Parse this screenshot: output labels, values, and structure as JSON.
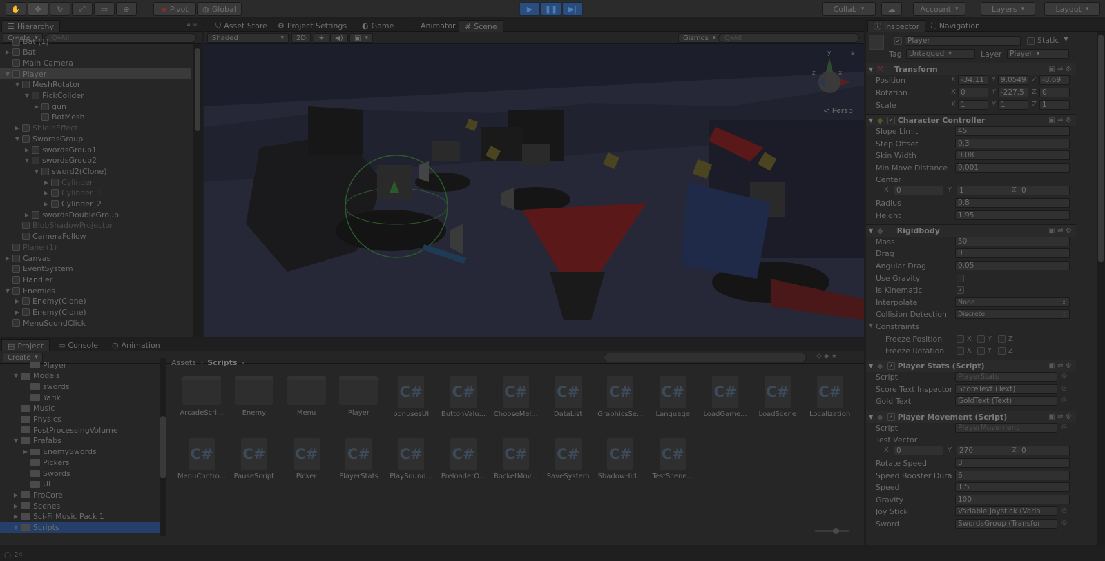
{
  "toolbar": {
    "pivot": "Pivot",
    "global": "Global",
    "collab": "Collab",
    "account": "Account",
    "layers": "Layers",
    "layout": "Layout"
  },
  "hierarchy": {
    "tab": "Hierarchy",
    "create": "Create",
    "search_placeholder": "Q▾All",
    "rows": [
      {
        "label": "Bat (1)",
        "indent": 1,
        "arrow": "",
        "dim": false
      },
      {
        "label": "Bat",
        "indent": 1,
        "arrow": "▶",
        "dim": false
      },
      {
        "label": "Main Camera",
        "indent": 1,
        "arrow": "",
        "dim": false
      },
      {
        "label": "Player",
        "indent": 1,
        "arrow": "▼",
        "dim": false,
        "sel": true
      },
      {
        "label": "MeshRotator",
        "indent": 2,
        "arrow": "▼",
        "dim": false
      },
      {
        "label": "PickColider",
        "indent": 3,
        "arrow": "▼",
        "dim": false
      },
      {
        "label": "gun",
        "indent": 4,
        "arrow": "▶",
        "dim": false
      },
      {
        "label": "BotMesh",
        "indent": 4,
        "arrow": "",
        "dim": false
      },
      {
        "label": "ShieldEffect",
        "indent": 2,
        "arrow": "▶",
        "dim": true
      },
      {
        "label": "SwordsGroup",
        "indent": 2,
        "arrow": "▼",
        "dim": false
      },
      {
        "label": "swordsGroup1",
        "indent": 3,
        "arrow": "▶",
        "dim": false
      },
      {
        "label": "swordsGroup2",
        "indent": 3,
        "arrow": "▼",
        "dim": false
      },
      {
        "label": "sword2(Clone)",
        "indent": 4,
        "arrow": "▼",
        "dim": false
      },
      {
        "label": "Cylinder",
        "indent": 5,
        "arrow": "▶",
        "dim": true
      },
      {
        "label": "Cylinder_1",
        "indent": 5,
        "arrow": "▶",
        "dim": true
      },
      {
        "label": "Cylinder_2",
        "indent": 5,
        "arrow": "▶",
        "dim": false
      },
      {
        "label": "swordsDoubleGroup",
        "indent": 3,
        "arrow": "▶",
        "dim": false
      },
      {
        "label": "BlobShadowProjector",
        "indent": 2,
        "arrow": "",
        "dim": true
      },
      {
        "label": "CameraFollow",
        "indent": 2,
        "arrow": "",
        "dim": false
      },
      {
        "label": "Plane (1)",
        "indent": 1,
        "arrow": "",
        "dim": true
      },
      {
        "label": "Canvas",
        "indent": 1,
        "arrow": "▶",
        "dim": false
      },
      {
        "label": "EventSystem",
        "indent": 1,
        "arrow": "",
        "dim": false
      },
      {
        "label": "Handler",
        "indent": 1,
        "arrow": "",
        "dim": false
      },
      {
        "label": "Enemies",
        "indent": 1,
        "arrow": "▼",
        "dim": false
      },
      {
        "label": "Enemy(Clone)",
        "indent": 2,
        "arrow": "▶",
        "dim": false
      },
      {
        "label": "Enemy(Clone)",
        "indent": 2,
        "arrow": "▶",
        "dim": false
      },
      {
        "label": "MenuSoundClick",
        "indent": 1,
        "arrow": "",
        "dim": false
      }
    ]
  },
  "center_tabs": {
    "asset_store": "Asset Store",
    "project_settings": "Project Settings",
    "game": "Game",
    "animator": "Animator",
    "scene": "Scene"
  },
  "scene": {
    "shading": "Shaded",
    "mode_2d": "2D",
    "gizmos": "Gizmos",
    "search_placeholder": "Q▾All",
    "persp": "< Persp",
    "gizmo_axes": {
      "x": "x",
      "y": "y",
      "z": "z"
    }
  },
  "inspector": {
    "tab": "Inspector",
    "nav_tab": "Navigation",
    "name": "Player",
    "static_label": "Static",
    "tag_label": "Tag",
    "tag_value": "Untagged",
    "layer_label": "Layer",
    "layer_value": "Player",
    "transform": {
      "title": "Transform",
      "position_label": "Position",
      "position": {
        "x": "-34.11",
        "y": "9.0549",
        "z": "-8.69"
      },
      "rotation_label": "Rotation",
      "rotation": {
        "x": "0",
        "y": "-227.5",
        "z": "0"
      },
      "scale_label": "Scale",
      "scale": {
        "x": "1",
        "y": "1",
        "z": "1"
      }
    },
    "character_controller": {
      "title": "Character Controller",
      "slope_limit_label": "Slope Limit",
      "slope_limit": "45",
      "step_offset_label": "Step Offset",
      "step_offset": "0.3",
      "skin_width_label": "Skin Width",
      "skin_width": "0.08",
      "min_move_label": "Min Move Distance",
      "min_move": "0.001",
      "center_label": "Center",
      "center": {
        "x": "0",
        "y": "1",
        "z": "0"
      },
      "radius_label": "Radius",
      "radius": "0.8",
      "height_label": "Height",
      "height": "1.95"
    },
    "rigidbody": {
      "title": "Rigidbody",
      "mass_label": "Mass",
      "mass": "50",
      "drag_label": "Drag",
      "drag": "0",
      "angular_drag_label": "Angular Drag",
      "angular_drag": "0.05",
      "use_gravity_label": "Use Gravity",
      "use_gravity": false,
      "is_kinematic_label": "Is Kinematic",
      "is_kinematic": true,
      "interpolate_label": "Interpolate",
      "interpolate": "None",
      "collision_label": "Collision Detection",
      "collision": "Discrete",
      "constraints_label": "Constraints",
      "freeze_position_label": "Freeze Position",
      "freeze_rotation_label": "Freeze Rotation"
    },
    "player_stats": {
      "title": "Player Stats (Script)",
      "script_label": "Script",
      "script": "PlayerStats",
      "score_label": "Score Text Inspector",
      "score": "ScoreText (Text)",
      "gold_label": "Gold Text",
      "gold": "GoldText (Text)"
    },
    "player_movement": {
      "title": "Player Movement (Script)",
      "script_label": "Script",
      "script": "PlayerMovement",
      "test_vector_label": "Test Vector",
      "test_vector": {
        "x": "0",
        "y": "270",
        "z": "0"
      },
      "rotate_speed_label": "Rotate Speed",
      "rotate_speed": "3",
      "booster_label": "Speed Booster Dura",
      "booster": "6",
      "speed_label": "Speed",
      "speed": "1.5",
      "gravity_label": "Gravity",
      "gravity": "100",
      "joystick_label": "Joy Stick",
      "joystick": "Variable Joystick (Varia",
      "sword_label": "Sword",
      "sword": "SwordsGroup (Transfor"
    }
  },
  "bottom_tabs": {
    "project": "Project",
    "console": "Console",
    "animation": "Animation"
  },
  "project": {
    "create": "Create",
    "breadcrumb": [
      "Assets",
      "Scripts"
    ],
    "folders": [
      {
        "label": "Player",
        "indent": 2,
        "arrow": ""
      },
      {
        "label": "Models",
        "indent": 1,
        "arrow": "▼"
      },
      {
        "label": "swords",
        "indent": 2,
        "arrow": ""
      },
      {
        "label": "Yarik",
        "indent": 2,
        "arrow": ""
      },
      {
        "label": "Music",
        "indent": 1,
        "arrow": ""
      },
      {
        "label": "Physics",
        "indent": 1,
        "arrow": ""
      },
      {
        "label": "PostProcessingVolume",
        "indent": 1,
        "arrow": ""
      },
      {
        "label": "Prefabs",
        "indent": 1,
        "arrow": "▼"
      },
      {
        "label": "EnemySwords",
        "indent": 2,
        "arrow": "▶"
      },
      {
        "label": "Pickers",
        "indent": 2,
        "arrow": ""
      },
      {
        "label": "Swords",
        "indent": 2,
        "arrow": ""
      },
      {
        "label": "UI",
        "indent": 2,
        "arrow": ""
      },
      {
        "label": "ProCore",
        "indent": 1,
        "arrow": "▶"
      },
      {
        "label": "Scenes",
        "indent": 1,
        "arrow": "▶"
      },
      {
        "label": "Sci-Fi Music Pack 1",
        "indent": 1,
        "arrow": "▶"
      },
      {
        "label": "Scripts",
        "indent": 1,
        "arrow": "▼",
        "sel": true
      }
    ],
    "assets_row1": [
      {
        "label": "ArcadeScri...",
        "kind": "folder"
      },
      {
        "label": "Enemy",
        "kind": "folder"
      },
      {
        "label": "Menu",
        "kind": "folder"
      },
      {
        "label": "Player",
        "kind": "folder"
      },
      {
        "label": "bonusesUI",
        "kind": "cs"
      },
      {
        "label": "ButtonValu...",
        "kind": "cs"
      },
      {
        "label": "ChooseMel...",
        "kind": "cs"
      },
      {
        "label": "DataList",
        "kind": "cs"
      },
      {
        "label": "GraphicsSe...",
        "kind": "cs"
      },
      {
        "label": "Language",
        "kind": "cs"
      },
      {
        "label": "LoadGame...",
        "kind": "cs"
      },
      {
        "label": "LoadScene",
        "kind": "cs"
      },
      {
        "label": "Localization",
        "kind": "cs"
      }
    ],
    "assets_row2": [
      {
        "label": "MenuContro...",
        "kind": "cs"
      },
      {
        "label": "PauseScript",
        "kind": "cs"
      },
      {
        "label": "Picker",
        "kind": "cs"
      },
      {
        "label": "PlayerStats",
        "kind": "cs"
      },
      {
        "label": "PlaySound...",
        "kind": "cs"
      },
      {
        "label": "PreloaderO...",
        "kind": "cs"
      },
      {
        "label": "RocketMov...",
        "kind": "cs"
      },
      {
        "label": "SaveSystem",
        "kind": "cs"
      },
      {
        "label": "ShadowHid...",
        "kind": "cs"
      },
      {
        "label": "TestScene...",
        "kind": "cs"
      }
    ],
    "cs_glyph": "C#"
  },
  "status": {
    "count": "24"
  }
}
